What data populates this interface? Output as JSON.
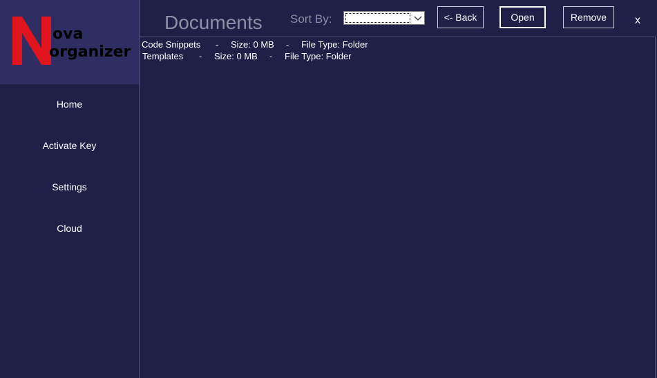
{
  "app": {
    "logo": {
      "letter": "N",
      "line1": "ova",
      "line2": "organizer",
      "letter_color": "#e0141e"
    },
    "colors": {
      "background": "#1f1f47",
      "logo_panel": "#2e2e63",
      "muted_text": "#8e8ea6",
      "text": "#ffffff"
    }
  },
  "sidebar": {
    "items": [
      {
        "label": "Home"
      },
      {
        "label": "Activate Key"
      },
      {
        "label": "Settings"
      },
      {
        "label": "Cloud"
      }
    ]
  },
  "header": {
    "title": "Documents",
    "sort_label": "Sort By:",
    "sort_value": "",
    "sort_icon": "chevron-down-icon",
    "back_label": "<- Back",
    "open_label": "Open",
    "remove_label": "Remove",
    "close_label": "x"
  },
  "list": {
    "rows": [
      {
        "name": "Code Snippets",
        "sep1": "-",
        "size": "Size: 0 MB",
        "sep2": "-",
        "type": "File Type: Folder"
      },
      {
        "name": "Templates",
        "sep1": "-",
        "size": "Size: 0 MB",
        "sep2": "-",
        "type": "File Type: Folder"
      }
    ]
  }
}
